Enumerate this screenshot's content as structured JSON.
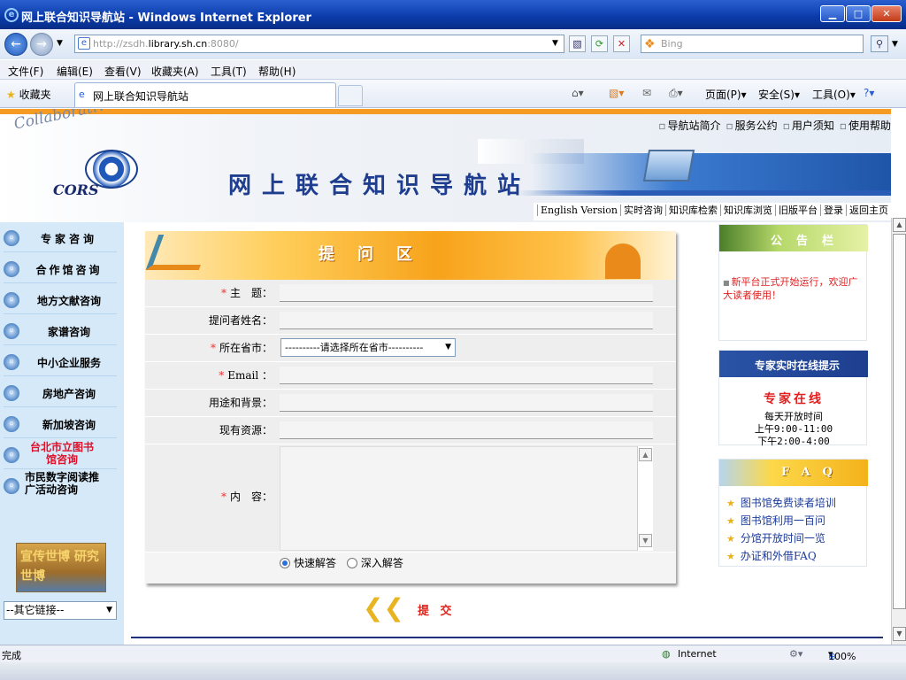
{
  "window": {
    "title": "网上联合知识导航站 - Windows Internet Explorer",
    "minimize": "▁",
    "maximize": "□",
    "close": "✕"
  },
  "address": {
    "url_prefix": "http://zsdh.",
    "url_domain": "library.sh.cn",
    "url_suffix": ":8080/",
    "search_placeholder": "Bing"
  },
  "menu": [
    "文件(F)",
    "编辑(E)",
    "查看(V)",
    "收藏夹(A)",
    "工具(T)",
    "帮助(H)"
  ],
  "favbar": {
    "favorites": "收藏夹",
    "tab_title": "网上联合知识导航站",
    "page": "页面(P)",
    "safety": "安全(S)",
    "tools": "工具(O)"
  },
  "banner": {
    "script": "Collaborative Online Reference Services",
    "logo": "CORS",
    "title": "网上联合知识导航站",
    "top_links": [
      "导航站简介",
      "服务公约",
      "用户须知",
      "使用帮助"
    ],
    "sub_links": [
      "English Version",
      "实时咨询",
      "知识库检索",
      "知识库浏览",
      "旧版平台",
      "登录",
      "返回主页"
    ]
  },
  "sidebar": {
    "items": [
      "专家咨询",
      "合作馆咨询",
      "地方文献咨询",
      "家谱咨询",
      "中小企业服务",
      "房地产咨询",
      "新加坡咨询",
      "台北市立图书馆咨询",
      "市民数字阅读推广活动咨询"
    ],
    "promo": "宣传世博 研究世博",
    "other_links": "--其它链接--"
  },
  "form": {
    "title": "提问区",
    "fields": [
      {
        "label": "主　题：",
        "required": true
      },
      {
        "label": "提问者姓名：",
        "required": false
      },
      {
        "label": "所在省市：",
        "required": true
      },
      {
        "label": "Email ：",
        "required": true
      },
      {
        "label": "用途和背景：",
        "required": false
      },
      {
        "label": "现有资源：",
        "required": false
      }
    ],
    "province_placeholder": "----------请选择所在省市----------",
    "content_label": "内　容：",
    "radio_fast": "快速解答",
    "radio_deep": "深入解答",
    "submit": "提 交",
    "required_mark": "*"
  },
  "notice": {
    "title": "公告栏",
    "text": "新平台正式开始运行，欢迎广大读者使用！"
  },
  "expert": {
    "title": "专家实时在线提示",
    "online": "专家在线",
    "lines": [
      "每天开放时间",
      "上午9:00-11:00",
      "下午2:00-4:00"
    ]
  },
  "faq": {
    "title": "FAQ",
    "items": [
      "图书馆免费读者培训",
      "图书馆利用一百问",
      "分馆开放时间一览",
      "办证和外借FAQ"
    ]
  },
  "status": {
    "done": "完成",
    "zone": "Internet",
    "zoom": "100%"
  }
}
